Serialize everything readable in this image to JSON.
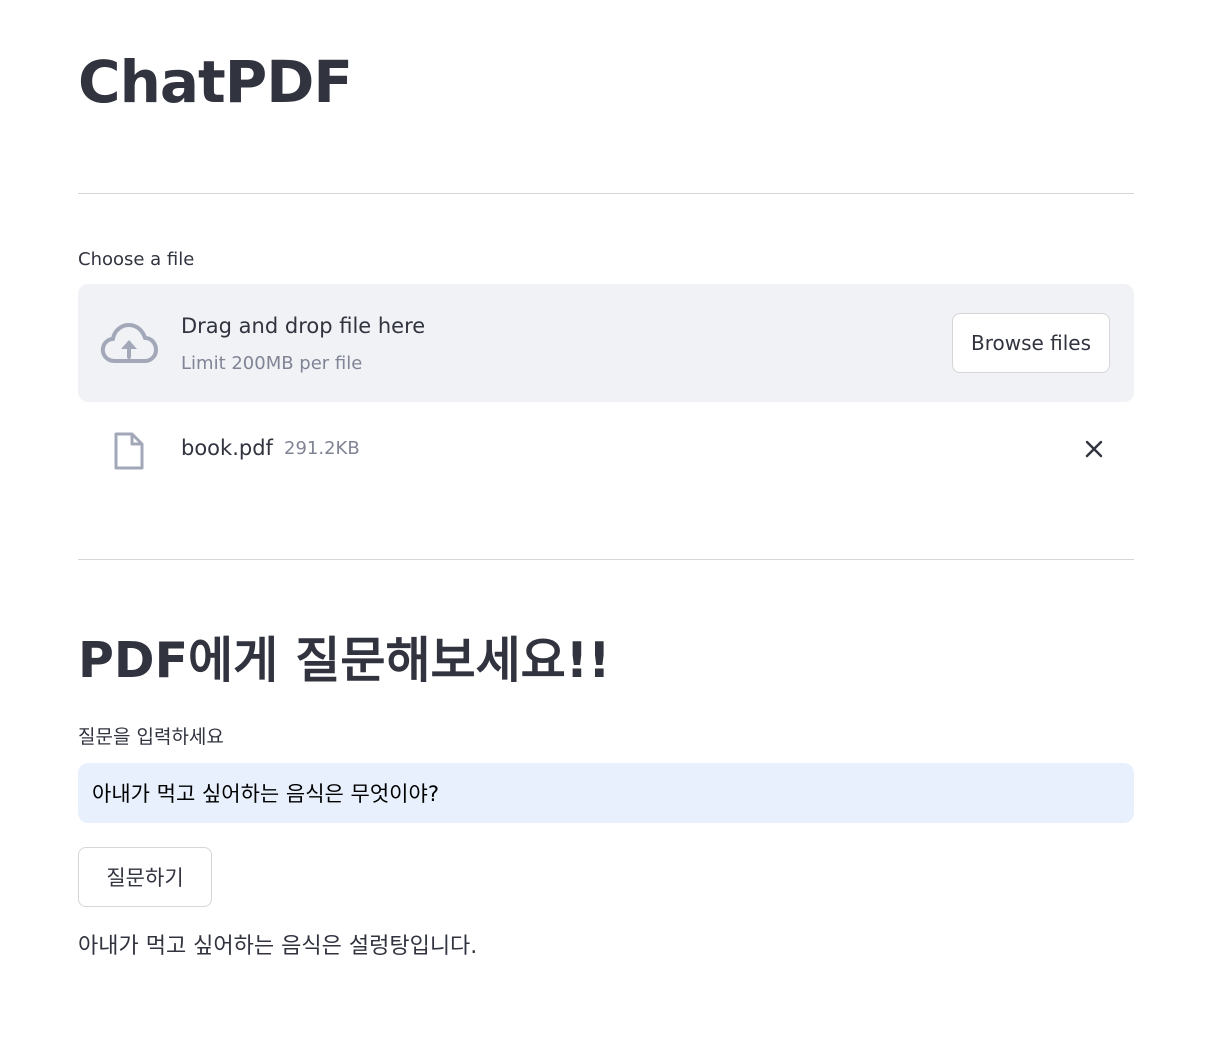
{
  "app": {
    "title": "ChatPDF"
  },
  "uploader": {
    "label": "Choose a file",
    "drop_title": "Drag and drop file here",
    "drop_limit": "Limit 200MB per file",
    "browse_label": "Browse files",
    "icon": "cloud-upload-icon"
  },
  "uploaded_file": {
    "name": "book.pdf",
    "size": "291.2KB",
    "icon": "file-icon",
    "remove_icon": "close-icon"
  },
  "qa": {
    "section_title": "PDF에게 질문해보세요!!",
    "question_label": "질문을 입력하세요",
    "question_value": "아내가 먹고 싶어하는 음식은 무엇이야?",
    "ask_label": "질문하기",
    "answer": "아내가 먹고 싶어하는 음식은 설렁탕입니다."
  },
  "colors": {
    "text": "#31333f",
    "muted": "#808495",
    "dropzone_bg": "#f0f2f6",
    "input_bg": "#e8f0fe",
    "icon_gray": "#a3a8b8",
    "border": "#d6d6d9"
  }
}
